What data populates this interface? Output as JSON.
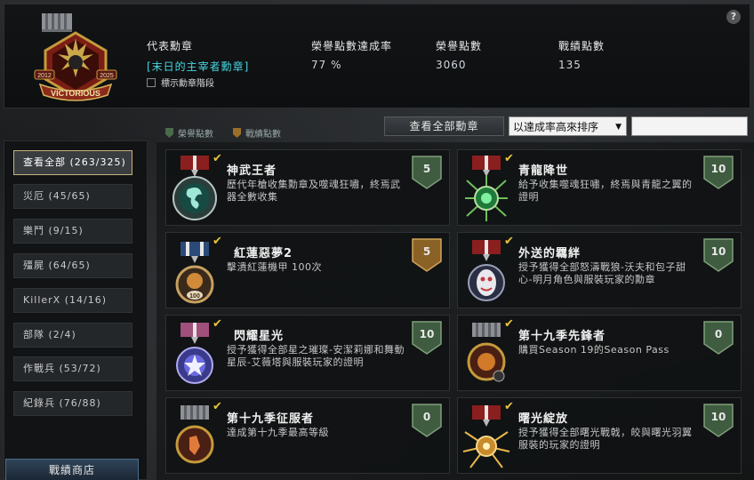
{
  "header": {
    "help_label": "?",
    "medal_years": {
      "left": "2012",
      "right": "2025"
    },
    "medal_banner": "VICTORIOUS",
    "representative": {
      "label": "代表勳章",
      "value": "[末日的主宰者勳章]"
    },
    "honor_rate": {
      "label": "榮譽點數達成率",
      "value": "77 %"
    },
    "honor_points": {
      "label": "榮譽點數",
      "value": "3060"
    },
    "battle_points": {
      "label": "戰績點數",
      "value": "135"
    },
    "show_rank_label": "標示勳章階段"
  },
  "toolbar": {
    "legend_honor": "榮譽點數",
    "legend_battle": "戰績點數",
    "view_all": "查看全部勳章",
    "sort_value": "以達成率高來排序",
    "search_value": ""
  },
  "sidebar": {
    "items": [
      {
        "label": "查看全部 (263/325)",
        "active": true
      },
      {
        "label": "災厄 (45/65)"
      },
      {
        "label": "樂鬥 (9/15)"
      },
      {
        "label": "殭屍 (64/65)"
      },
      {
        "label": "KillerX (14/16)"
      },
      {
        "label": "部隊 (2/4)"
      },
      {
        "label": "作戰兵 (53/72)"
      },
      {
        "label": "紀錄兵 (76/88)"
      }
    ],
    "shop_label": "戰績商店"
  },
  "colors": {
    "accent_cyan": "#46d6e0",
    "check_gold": "#e8c43a",
    "honor_green": "#4b6b4a",
    "battle_gold": "#9a6f2a"
  },
  "medals": [
    {
      "title": "神武王者",
      "desc": "歷代年槍收集勳章及噬魂狂嘯，終焉武器全數收集",
      "points": "5",
      "point_type": "honor",
      "icon": "dragon-emblem-icon",
      "ribbon": "red"
    },
    {
      "title": "青龍降世",
      "desc": "給予收集噬魂狂嘯，終焉與青龍之翼的證明",
      "points": "10",
      "point_type": "honor",
      "icon": "green-dragon-orb-icon",
      "ribbon": "red"
    },
    {
      "title": "紅蓮惡夢2",
      "desc": "擊潰紅蓮機甲 100次",
      "points": "5",
      "point_type": "battle",
      "icon": "lion-100-icon",
      "ribbon": "blue"
    },
    {
      "title": "外送的羈絆",
      "desc": "授予獲得全部怒濤戰狼-沃夫和包子甜心-明月角色與服裝玩家的勳章",
      "points": "10",
      "point_type": "honor",
      "icon": "mask-icon",
      "ribbon": "red"
    },
    {
      "title": "閃耀星光",
      "desc": "授予獲得全部星之璀璨-安潔莉娜和舞動星辰-艾薇塔與服裝玩家的證明",
      "points": "10",
      "point_type": "honor",
      "icon": "star-crystal-icon",
      "ribbon": "pink"
    },
    {
      "title": "第十九季先鋒者",
      "desc": "購買Season 19的Season Pass",
      "points": "0",
      "point_type": "honor",
      "icon": "season-vanguard-icon",
      "ribbon": "silver"
    },
    {
      "title": "第十九季征服者",
      "desc": "達成第十九季最高等級",
      "points": "0",
      "point_type": "honor",
      "icon": "season-conqueror-icon",
      "ribbon": "silver"
    },
    {
      "title": "曙光綻放",
      "desc": "授予獲得全部曙光戰戟，皎與曙光羽翼服裝的玩家的證明",
      "points": "10",
      "point_type": "honor",
      "icon": "golden-wings-icon",
      "ribbon": "red"
    }
  ]
}
